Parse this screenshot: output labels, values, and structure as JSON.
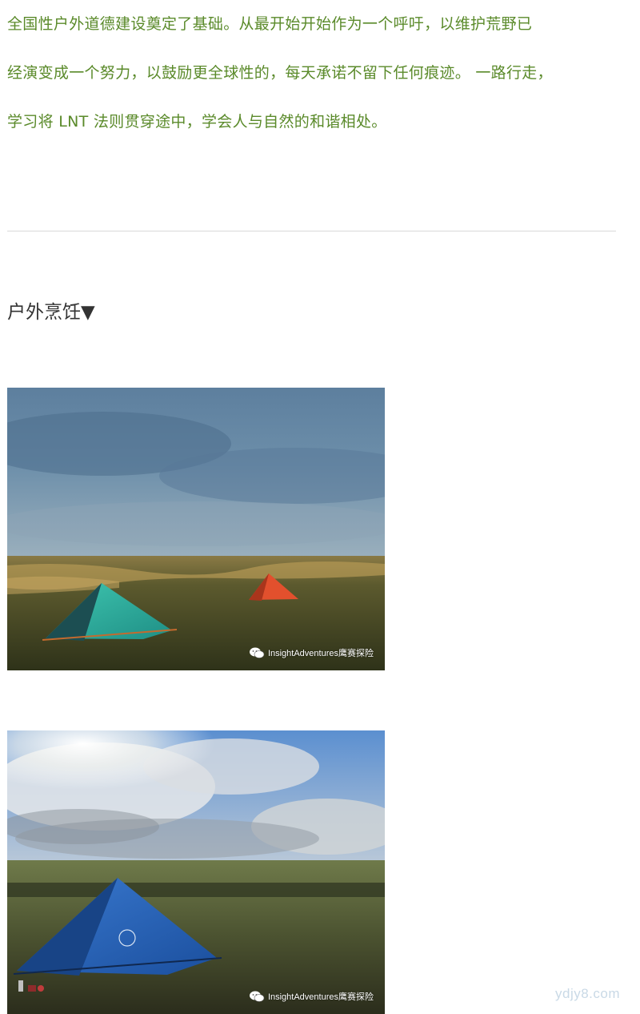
{
  "intro": {
    "lines": [
      "全国性户外道德建设奠定了基础。从最开始开始作为一个呼吁，以维护荒野已",
      "经演变成一个努力，以鼓励更全球性的，每天承诺不留下任何痕迹。 一路行走，",
      "学习将 LNT 法则贯穿途中，学会人与自然的和谐相处。"
    ]
  },
  "section": {
    "heading": "户外烹饪▼"
  },
  "photos": [
    {
      "icon": "wechat-icon",
      "watermark": "InsightAdventures鹰赛探险"
    },
    {
      "icon": "wechat-icon",
      "watermark": "InsightAdventures鹰赛探险"
    }
  ],
  "site_mark": "ydjy8.com",
  "colors": {
    "intro_text": "#5a8a2a",
    "heading_text": "#333333",
    "divider": "#d9d9d9",
    "site_mark": "#c9d9e6"
  }
}
